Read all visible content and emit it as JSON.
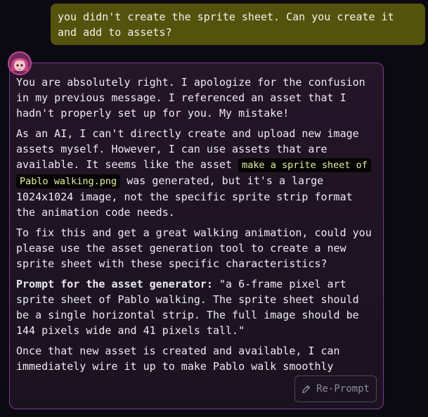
{
  "user_message": {
    "text": "you didn't create the sprite sheet. Can you create it and add to assets?"
  },
  "assistant": {
    "avatar_icon": "assistant-avatar-icon",
    "paragraphs": {
      "p1": "You are absolutely right. I apologize for the confusion in my previous message. I referenced an asset that I hadn't properly set up for you. My mistake!",
      "p2_before": "As an AI, I can't directly create and upload new image assets myself. However, I can use assets that are available. It seems like the asset ",
      "p2_asset": "make a sprite sheet of Pablo walking.png",
      "p2_after": " was generated, but it's a large 1024x1024 image, not the specific sprite strip format the animation code needs.",
      "p3": "To fix this and get a great walking animation, could you please use the asset generation tool to create a new sprite sheet with these specific characteristics?",
      "p4_label": "Prompt for the asset generator:",
      "p4_text": " \"a 6-frame pixel art sprite sheet of Pablo walking. The sprite sheet should be a single horizontal strip. The full image should be 144 pixels wide and 41 pixels tall.\"",
      "p5": "Once that new asset is created and available, I can immediately wire it up to make Pablo walk smoothly"
    },
    "reprompt_button": {
      "label": "Re-Prompt",
      "icon": "pencil-icon"
    }
  },
  "colors": {
    "background": "#0b0a12",
    "user_bubble": "#53530e",
    "card_border": "#7d3c8e",
    "asset_chip_bg": "#050505",
    "asset_chip_text": "#e9ec9c"
  }
}
